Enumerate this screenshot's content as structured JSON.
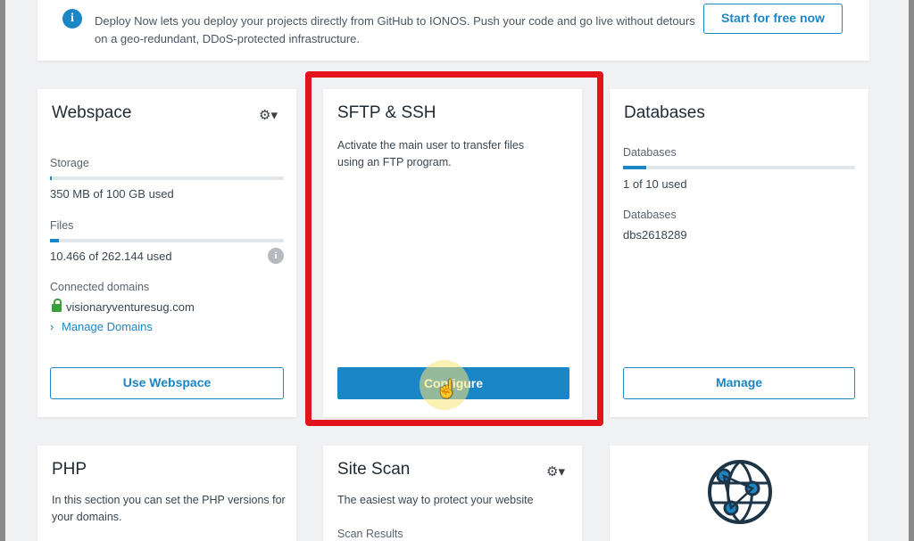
{
  "banner": {
    "text": "Deploy Now lets you deploy your projects directly from GitHub to IONOS. Push your code and go live without detours on a geo-redundant, DDoS-protected infrastructure.",
    "button": "Start for free now"
  },
  "webspace": {
    "title": "Webspace",
    "storage_label": "Storage",
    "storage_value": "350 MB of 100 GB used",
    "storage_fraction": 0.0035,
    "files_label": "Files",
    "files_value": "10.466 of 262.144 used",
    "files_fraction": 0.04,
    "domains_label": "Connected domains",
    "domain": "visionaryventuresug.com",
    "manage_link": "Manage Domains",
    "button": "Use Webspace"
  },
  "sftp": {
    "title": "SFTP & SSH",
    "description": "Activate the main user to transfer files using an FTP program.",
    "button": "Configure"
  },
  "databases": {
    "title": "Databases",
    "count_label": "Databases",
    "count_value": "1 of 10 used",
    "count_fraction": 0.1,
    "name_label": "Databases",
    "name_value": "dbs2618289",
    "button": "Manage"
  },
  "php": {
    "title": "PHP",
    "description": "In this section you can set the PHP versions for your domains."
  },
  "sitescan": {
    "title": "Site Scan",
    "description": "The easiest way to protect your website",
    "results_label": "Scan Results"
  },
  "colors": {
    "accent": "#1b86c6",
    "highlight": "#e4141c",
    "lock": "#3aa13a"
  },
  "icons": {
    "gear": "gear-icon",
    "info": "info-icon",
    "lock": "lock-icon",
    "globe": "globe-icon"
  }
}
